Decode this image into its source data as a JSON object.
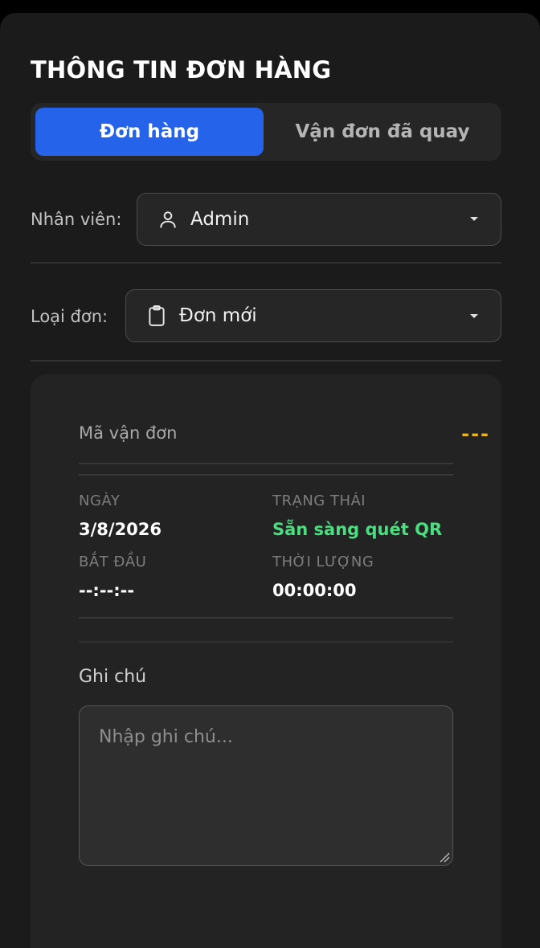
{
  "header": {
    "title": "THÔNG TIN ĐƠN HÀNG"
  },
  "tabs": [
    {
      "label": "Đơn hàng",
      "active": true
    },
    {
      "label": "Vận đơn đã quay",
      "active": false
    }
  ],
  "staff": {
    "label": "Nhân viên:",
    "value": "Admin",
    "icon": "user-icon"
  },
  "order_type": {
    "label": "Loại đơn:",
    "value": "Đơn mới",
    "icon": "clipboard-icon"
  },
  "tracking": {
    "label": "Mã vận đơn",
    "value": "---"
  },
  "meta": {
    "date_label": "NGÀY",
    "date_value": "3/8/2026",
    "status_label": "TRẠNG THÁI",
    "status_value": "Sẵn sàng quét QR",
    "start_label": "BẮT ĐẦU",
    "start_value": "--:--:--",
    "duration_label": "THỜI LƯỢNG",
    "duration_value": "00:00:00"
  },
  "notes": {
    "label": "Ghi chú",
    "placeholder": "Nhập ghi chú...",
    "value": ""
  },
  "colors": {
    "accent": "#2563eb",
    "status_green": "#4ade80",
    "tracking_yellow": "#e8b41c",
    "background": "#1b1b1b"
  }
}
